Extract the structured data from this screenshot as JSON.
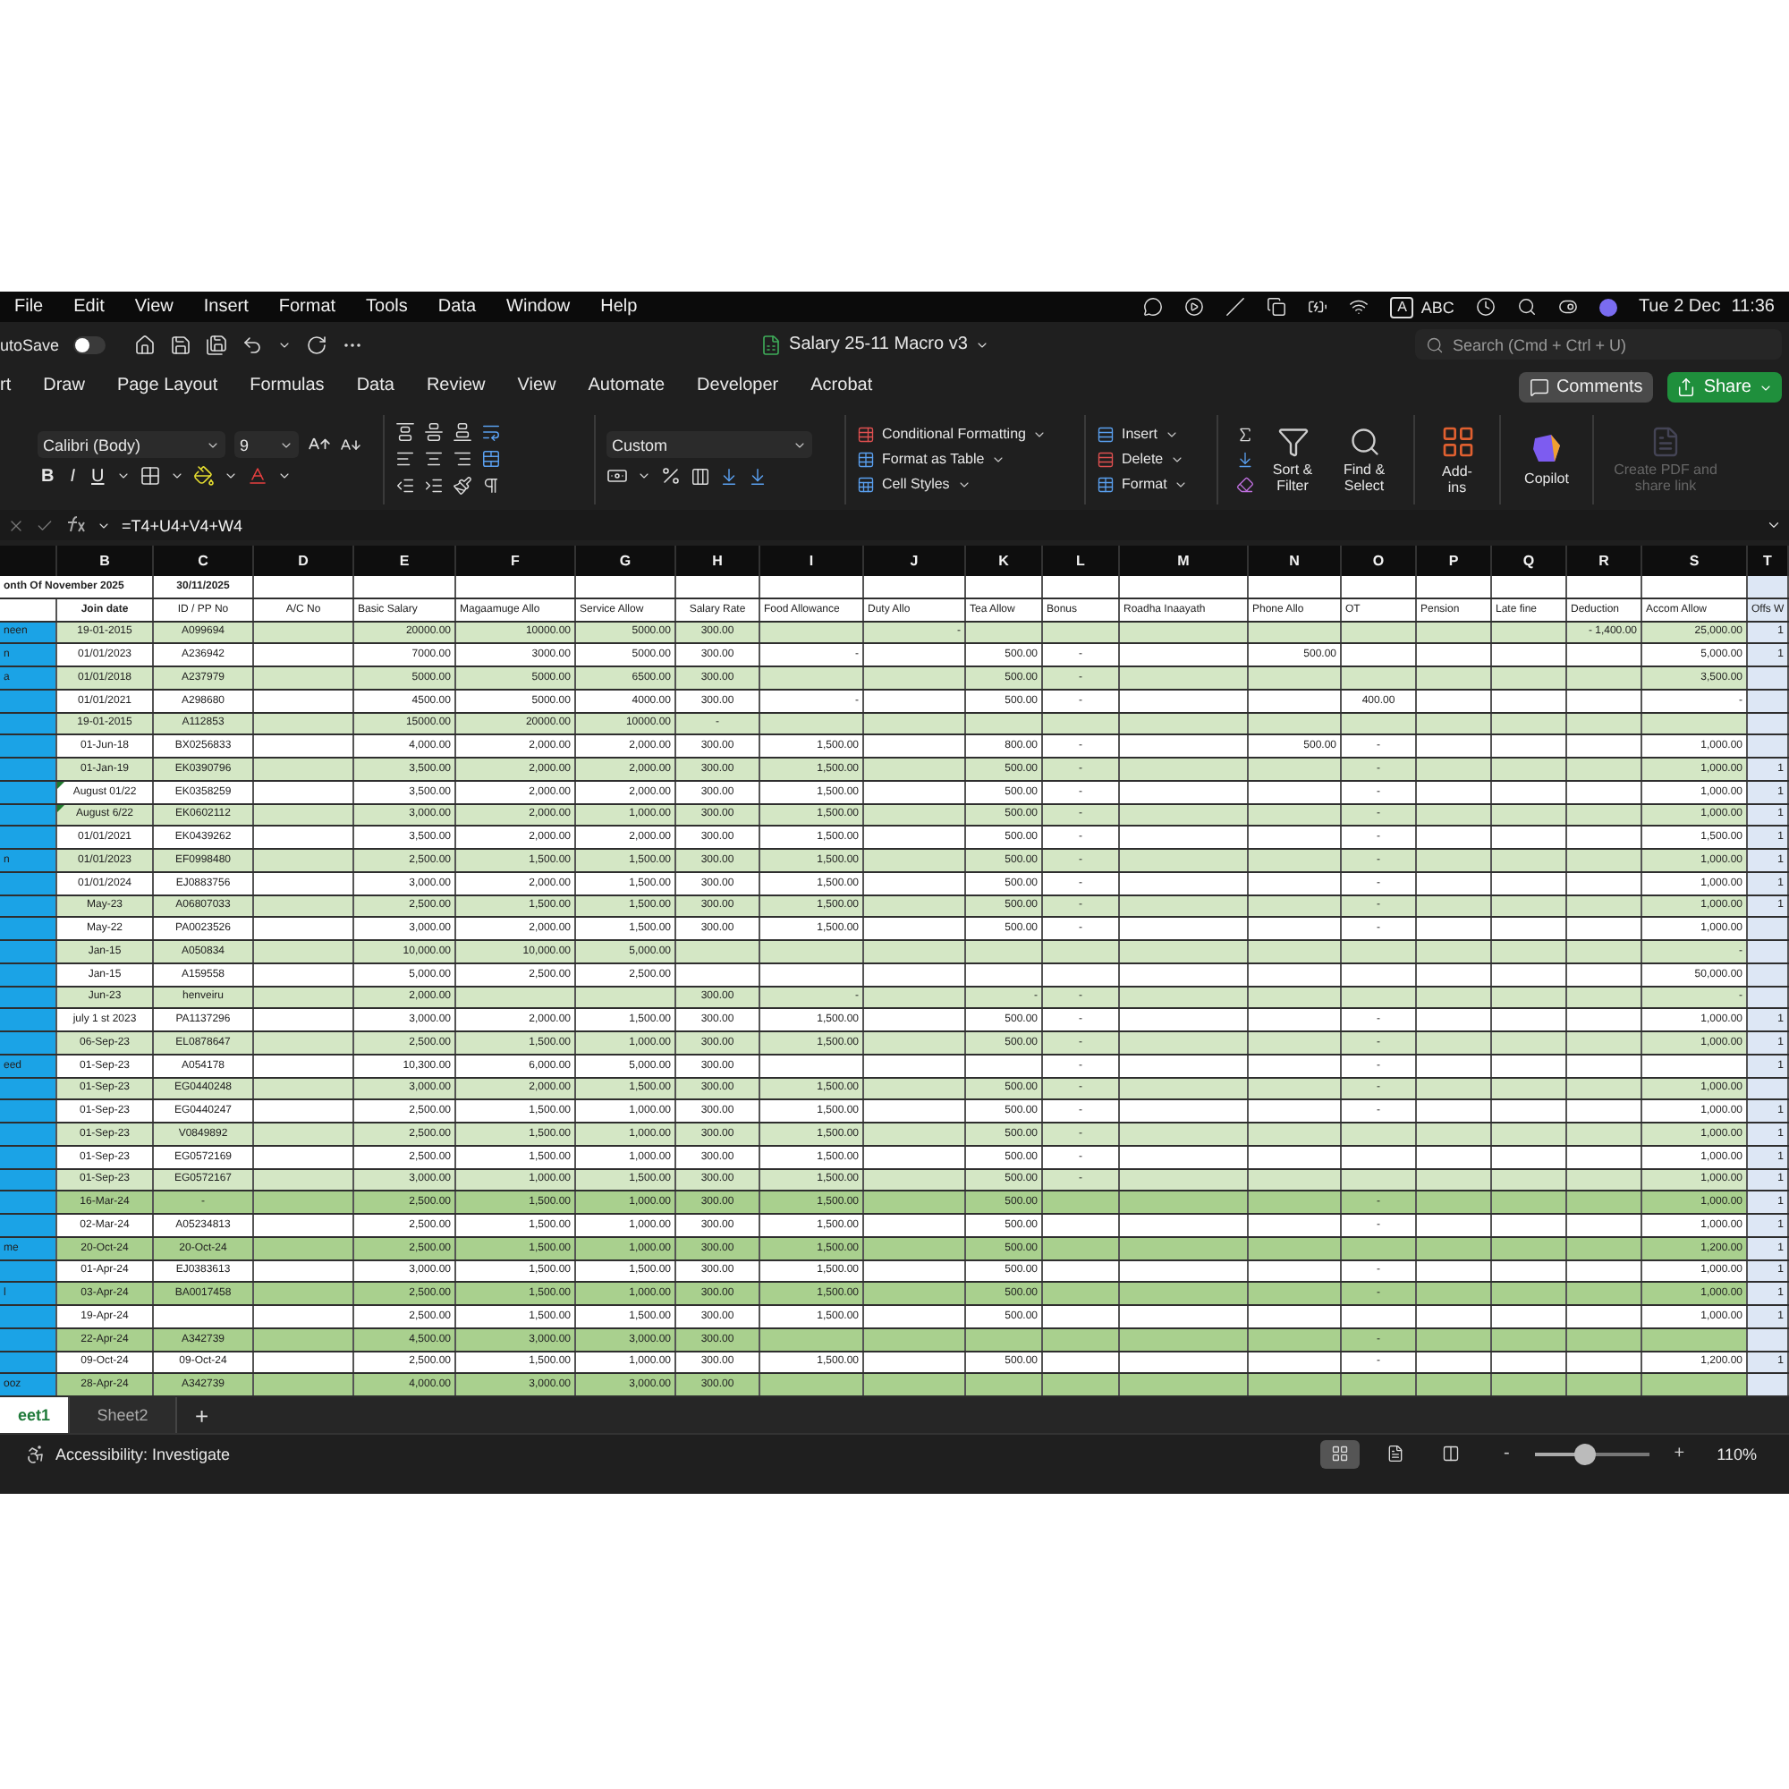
{
  "menu_bar": {
    "items": [
      "File",
      "Edit",
      "View",
      "Insert",
      "Format",
      "Tools",
      "Data",
      "Window",
      "Help"
    ],
    "input_source_badge": "A",
    "input_source": "ABC",
    "date": "Tue 2 Dec",
    "time": "11:36"
  },
  "title_bar": {
    "autosave_label": "utoSave",
    "autosave_on": false,
    "document_title": "Salary 25-11 Macro v3",
    "search": {
      "placeholder": "Search (Cmd + Ctrl + U)"
    }
  },
  "ribbon_tabs": [
    {
      "label": "rt",
      "selected": false
    },
    {
      "label": "Draw",
      "selected": false
    },
    {
      "label": "Page Layout",
      "selected": false
    },
    {
      "label": "Formulas",
      "selected": false
    },
    {
      "label": "Data",
      "selected": false
    },
    {
      "label": "Review",
      "selected": false
    },
    {
      "label": "View",
      "selected": false
    },
    {
      "label": "Automate",
      "selected": false
    },
    {
      "label": "Developer",
      "selected": false
    },
    {
      "label": "Acrobat",
      "selected": false
    }
  ],
  "ribbon_buttons": {
    "comments": "Comments",
    "share": "Share"
  },
  "ribbon": {
    "font": "Calibri (Body)",
    "font_size": "9",
    "text_styles": [
      "B",
      "I",
      "U"
    ],
    "number_format": "Custom",
    "styles": [
      "Conditional Formatting",
      "Format as Table",
      "Cell Styles"
    ],
    "cells": [
      "Insert",
      "Delete",
      "Format"
    ],
    "editing": [
      "Sort & Filter",
      "Find & Select"
    ],
    "add_ins": "Add-ins",
    "copilot": "Copilot",
    "create_pdf": {
      "label": "Create PDF and share link",
      "disabled": true
    }
  },
  "formula_bar": {
    "formula": "=T4+U4+V4+W4"
  },
  "sheet": {
    "columns": [
      "B",
      "C",
      "D",
      "E",
      "F",
      "G",
      "H",
      "I",
      "J",
      "K",
      "L",
      "M",
      "N",
      "O",
      "P",
      "Q",
      "R",
      "S",
      "T"
    ],
    "title": "onth Of November 2025",
    "date": "30/11/2025",
    "headers": [
      "Join date",
      "ID / PP No",
      "A/C No",
      "Basic Salary",
      "Magaamuge Allo",
      "Service Allow",
      "Salary Rate",
      "Food Allowance",
      "Duty Allo",
      "Tea Allow",
      "Bonus",
      "Roadha Inaayath",
      "Phone Allo",
      "OT",
      "Pension",
      "Late fine",
      "Deduction",
      "Accom Allow",
      "Offs W"
    ],
    "rows": [
      {
        "name": "neen",
        "color": "#d4e7c5",
        "flagged": false,
        "cells": [
          "19-01-2015",
          "A099694",
          null,
          "20000.00",
          "10000.00",
          "5000.00",
          "300.00",
          null,
          "-",
          null,
          null,
          null,
          null,
          null,
          null,
          null,
          "- 1,400.00",
          "25,000.00",
          "1"
        ]
      },
      {
        "name": "n",
        "color": "#ffffff",
        "flagged": false,
        "cells": [
          "01/01/2023",
          "A236942",
          null,
          "7000.00",
          "3000.00",
          "5000.00",
          "300.00",
          "-",
          null,
          "500.00",
          "-",
          null,
          "500.00",
          null,
          null,
          null,
          null,
          "5,000.00",
          "1"
        ]
      },
      {
        "name": "a",
        "color": "#d4e7c5",
        "flagged": false,
        "cells": [
          "01/01/2018",
          "A237979",
          null,
          "5000.00",
          "5000.00",
          "6500.00",
          "300.00",
          null,
          null,
          "500.00",
          "-",
          null,
          null,
          null,
          null,
          null,
          null,
          "3,500.00",
          null
        ]
      },
      {
        "color": "#ffffff",
        "flagged": false,
        "cells": [
          "01/01/2021",
          "A298680",
          null,
          "4500.00",
          "5000.00",
          "4000.00",
          "300.00",
          "-",
          null,
          "500.00",
          "-",
          null,
          null,
          "400.00",
          null,
          null,
          null,
          "-",
          null
        ]
      },
      {
        "color": "#d4e7c5",
        "flagged": false,
        "cells": [
          "19-01-2015",
          "A112853",
          null,
          "15000.00",
          "20000.00",
          "10000.00",
          "-",
          null,
          null,
          null,
          null,
          null,
          null,
          null,
          null,
          null,
          null,
          null,
          null
        ]
      },
      {
        "color": "#ffffff",
        "flagged": false,
        "cells": [
          "01-Jun-18",
          "BX0256833",
          null,
          "4,000.00",
          "2,000.00",
          "2,000.00",
          "300.00",
          "1,500.00",
          null,
          "800.00",
          "-",
          null,
          "500.00",
          "-",
          null,
          null,
          null,
          "1,000.00",
          null
        ]
      },
      {
        "color": "#d4e7c5",
        "flagged": false,
        "cells": [
          "01-Jan-19",
          "EK0390796",
          null,
          "3,500.00",
          "2,000.00",
          "2,000.00",
          "300.00",
          "1,500.00",
          null,
          "500.00",
          "-",
          null,
          null,
          "-",
          null,
          null,
          null,
          "1,000.00",
          "1"
        ]
      },
      {
        "color": "#ffffff",
        "flagged": true,
        "cells": [
          "August 01/22",
          "EK0358259",
          null,
          "3,500.00",
          "2,000.00",
          "2,000.00",
          "300.00",
          "1,500.00",
          null,
          "500.00",
          "-",
          null,
          null,
          "-",
          null,
          null,
          null,
          "1,000.00",
          "1"
        ]
      },
      {
        "color": "#d4e7c5",
        "flagged": true,
        "cells": [
          "August 6/22",
          "EK0602112",
          null,
          "3,000.00",
          "2,000.00",
          "1,000.00",
          "300.00",
          "1,500.00",
          null,
          "500.00",
          "-",
          null,
          null,
          "-",
          null,
          null,
          null,
          "1,000.00",
          "1"
        ]
      },
      {
        "color": "#ffffff",
        "flagged": false,
        "cells": [
          "01/01/2021",
          "EK0439262",
          null,
          "3,500.00",
          "2,000.00",
          "2,000.00",
          "300.00",
          "1,500.00",
          null,
          "500.00",
          "-",
          null,
          null,
          "-",
          null,
          null,
          null,
          "1,500.00",
          "1"
        ]
      },
      {
        "name": "n",
        "color": "#d4e7c5",
        "flagged": false,
        "cells": [
          "01/01/2023",
          "EF0998480",
          null,
          "2,500.00",
          "1,500.00",
          "1,500.00",
          "300.00",
          "1,500.00",
          null,
          "500.00",
          "-",
          null,
          null,
          "-",
          null,
          null,
          null,
          "1,000.00",
          "1"
        ]
      },
      {
        "color": "#ffffff",
        "flagged": false,
        "cells": [
          "01/01/2024",
          "EJ0883756",
          null,
          "3,000.00",
          "2,000.00",
          "1,500.00",
          "300.00",
          "1,500.00",
          null,
          "500.00",
          "-",
          null,
          null,
          "-",
          null,
          null,
          null,
          "1,000.00",
          "1"
        ]
      },
      {
        "color": "#d4e7c5",
        "flagged": false,
        "cells": [
          "May-23",
          "A06807033",
          null,
          "2,500.00",
          "1,500.00",
          "1,500.00",
          "300.00",
          "1,500.00",
          null,
          "500.00",
          "-",
          null,
          null,
          "-",
          null,
          null,
          null,
          "1,000.00",
          "1"
        ]
      },
      {
        "color": "#ffffff",
        "flagged": false,
        "cells": [
          "May-22",
          "PA0023526",
          null,
          "3,000.00",
          "2,000.00",
          "1,500.00",
          "300.00",
          "1,500.00",
          null,
          "500.00",
          "-",
          null,
          null,
          "-",
          null,
          null,
          null,
          "1,000.00",
          null
        ]
      },
      {
        "color": "#d4e7c5",
        "flagged": false,
        "cells": [
          "Jan-15",
          "A050834",
          null,
          "10,000.00",
          "10,000.00",
          "5,000.00",
          null,
          null,
          null,
          null,
          null,
          null,
          null,
          null,
          null,
          null,
          null,
          "-",
          null
        ]
      },
      {
        "color": "#ffffff",
        "flagged": false,
        "cells": [
          "Jan-15",
          "A159558",
          null,
          "5,000.00",
          "2,500.00",
          "2,500.00",
          null,
          null,
          null,
          null,
          null,
          null,
          null,
          null,
          null,
          null,
          null,
          "50,000.00",
          null
        ]
      },
      {
        "color": "#d4e7c5",
        "flagged": false,
        "cells": [
          "Jun-23",
          "henveiru",
          null,
          "2,000.00",
          null,
          null,
          "300.00",
          "-",
          null,
          "-",
          "-",
          null,
          null,
          null,
          null,
          null,
          null,
          "-",
          null
        ]
      },
      {
        "color": "#ffffff",
        "flagged": false,
        "cells": [
          "july 1 st 2023",
          "PA1137296",
          null,
          "3,000.00",
          "2,000.00",
          "1,500.00",
          "300.00",
          "1,500.00",
          null,
          "500.00",
          "-",
          null,
          null,
          "-",
          null,
          null,
          null,
          "1,000.00",
          "1"
        ]
      },
      {
        "color": "#d4e7c5",
        "flagged": false,
        "cells": [
          "06-Sep-23",
          "EL0878647",
          null,
          "2,500.00",
          "1,500.00",
          "1,000.00",
          "300.00",
          "1,500.00",
          null,
          "500.00",
          "-",
          null,
          null,
          "-",
          null,
          null,
          null,
          "1,000.00",
          "1"
        ]
      },
      {
        "name": "eed",
        "color": "#ffffff",
        "flagged": false,
        "cells": [
          "01-Sep-23",
          "A054178",
          null,
          "10,300.00",
          "6,000.00",
          "5,000.00",
          "300.00",
          null,
          null,
          null,
          "-",
          null,
          null,
          "-",
          null,
          null,
          null,
          null,
          "1"
        ]
      },
      {
        "color": "#d4e7c5",
        "flagged": false,
        "cells": [
          "01-Sep-23",
          "EG0440248",
          null,
          "3,000.00",
          "2,000.00",
          "1,500.00",
          "300.00",
          "1,500.00",
          null,
          "500.00",
          "-",
          null,
          null,
          "-",
          null,
          null,
          null,
          "1,000.00",
          null
        ]
      },
      {
        "color": "#ffffff",
        "flagged": false,
        "cells": [
          "01-Sep-23",
          "EG0440247",
          null,
          "2,500.00",
          "1,500.00",
          "1,000.00",
          "300.00",
          "1,500.00",
          null,
          "500.00",
          "-",
          null,
          null,
          "-",
          null,
          null,
          null,
          "1,000.00",
          "1"
        ]
      },
      {
        "color": "#d4e7c5",
        "flagged": false,
        "cells": [
          "01-Sep-23",
          "V0849892",
          null,
          "2,500.00",
          "1,500.00",
          "1,000.00",
          "300.00",
          "1,500.00",
          null,
          "500.00",
          "-",
          null,
          null,
          null,
          null,
          null,
          null,
          "1,000.00",
          "1"
        ]
      },
      {
        "color": "#ffffff",
        "flagged": false,
        "cells": [
          "01-Sep-23",
          "EG0572169",
          null,
          "2,500.00",
          "1,500.00",
          "1,000.00",
          "300.00",
          "1,500.00",
          null,
          "500.00",
          "-",
          null,
          null,
          null,
          null,
          null,
          null,
          "1,000.00",
          "1"
        ]
      },
      {
        "color": "#d4e7c5",
        "flagged": false,
        "cells": [
          "01-Sep-23",
          "EG0572167",
          null,
          "3,000.00",
          "1,000.00",
          "1,500.00",
          "300.00",
          "1,500.00",
          null,
          "500.00",
          "-",
          null,
          null,
          null,
          null,
          null,
          null,
          "1,000.00",
          "1"
        ]
      },
      {
        "color": "#a9d08e",
        "flagged": false,
        "cells": [
          "16-Mar-24",
          "-",
          null,
          "2,500.00",
          "1,500.00",
          "1,000.00",
          "300.00",
          "1,500.00",
          null,
          "500.00",
          null,
          null,
          null,
          "-",
          null,
          null,
          null,
          "1,000.00",
          "1"
        ]
      },
      {
        "color": "#ffffff",
        "flagged": false,
        "cells": [
          "02-Mar-24",
          "A05234813",
          null,
          "2,500.00",
          "1,500.00",
          "1,000.00",
          "300.00",
          "1,500.00",
          null,
          "500.00",
          null,
          null,
          null,
          "-",
          null,
          null,
          null,
          "1,000.00",
          "1"
        ]
      },
      {
        "name": "me",
        "color": "#a9d08e",
        "flagged": false,
        "cells": [
          "20-Oct-24",
          "20-Oct-24",
          null,
          "2,500.00",
          "1,500.00",
          "1,000.00",
          "300.00",
          "1,500.00",
          null,
          "500.00",
          null,
          null,
          null,
          null,
          null,
          null,
          null,
          "1,200.00",
          "1"
        ]
      },
      {
        "color": "#ffffff",
        "flagged": false,
        "cells": [
          "01-Apr-24",
          "EJ0383613",
          null,
          "3,000.00",
          "1,500.00",
          "1,500.00",
          "300.00",
          "1,500.00",
          null,
          "500.00",
          null,
          null,
          null,
          "-",
          null,
          null,
          null,
          "1,000.00",
          "1"
        ]
      },
      {
        "name": "l",
        "color": "#a9d08e",
        "flagged": false,
        "cells": [
          "03-Apr-24",
          "BA0017458",
          null,
          "2,500.00",
          "1,500.00",
          "1,000.00",
          "300.00",
          "1,500.00",
          null,
          "500.00",
          null,
          null,
          null,
          "-",
          null,
          null,
          null,
          "1,000.00",
          "1"
        ]
      },
      {
        "color": "#ffffff",
        "flagged": false,
        "cells": [
          "19-Apr-24",
          null,
          null,
          "2,500.00",
          "1,500.00",
          "1,500.00",
          "300.00",
          "1,500.00",
          null,
          "500.00",
          null,
          null,
          null,
          null,
          null,
          null,
          null,
          "1,000.00",
          "1"
        ]
      },
      {
        "color": "#a9d08e",
        "flagged": false,
        "cells": [
          "22-Apr-24",
          "A342739",
          null,
          "4,500.00",
          "3,000.00",
          "3,000.00",
          "300.00",
          null,
          null,
          null,
          null,
          null,
          null,
          "-",
          null,
          null,
          null,
          null,
          null
        ]
      },
      {
        "color": "#ffffff",
        "flagged": false,
        "cells": [
          "09-Oct-24",
          "09-Oct-24",
          null,
          "2,500.00",
          "1,500.00",
          "1,000.00",
          "300.00",
          "1,500.00",
          null,
          "500.00",
          null,
          null,
          null,
          "-",
          null,
          null,
          null,
          "1,200.00",
          "1"
        ]
      },
      {
        "name": "ooz",
        "color": "#a9d08e",
        "flagged": false,
        "cells": [
          "28-Apr-24",
          "A342739",
          null,
          "4,000.00",
          "3,000.00",
          "3,000.00",
          "300.00",
          null,
          null,
          null,
          null,
          null,
          null,
          null,
          null,
          null,
          null,
          null,
          null
        ]
      }
    ]
  },
  "sheet_tabs": [
    {
      "label": "eet1",
      "selected": true
    },
    {
      "label": "Sheet2",
      "selected": false
    }
  ],
  "add_sheet": "+",
  "status_bar": {
    "accessibility": "Accessibility: Investigate",
    "views": [
      {
        "kind": "normal",
        "selected": true
      },
      {
        "kind": "page-layout",
        "selected": false
      },
      {
        "kind": "page-break",
        "selected": false
      }
    ],
    "zoom": {
      "minus": "-",
      "plus": "+",
      "level": 0.44,
      "reading": "110%"
    }
  }
}
